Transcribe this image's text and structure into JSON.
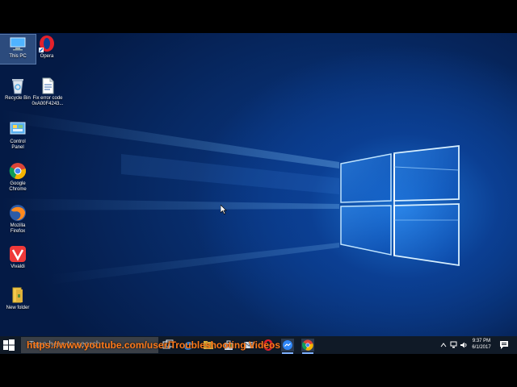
{
  "desktop": {
    "icons": [
      {
        "label_line1": "This PC",
        "label_line2": "",
        "icon": "this-pc-icon"
      },
      {
        "label_line1": "Opera",
        "label_line2": "",
        "icon": "opera-icon"
      },
      {
        "label_line1": "Recycle Bin",
        "label_line2": "",
        "icon": "recycle-bin-icon"
      },
      {
        "label_line1": "Fix error code",
        "label_line2": "0xA00F4243...",
        "icon": "document-icon"
      },
      {
        "label_line1": "Control",
        "label_line2": "Panel",
        "icon": "control-panel-icon"
      },
      {
        "label_line1": "Google",
        "label_line2": "Chrome",
        "icon": "chrome-icon"
      },
      {
        "label_line1": "Mozilla",
        "label_line2": "Firefox",
        "icon": "firefox-icon"
      },
      {
        "label_line1": "Vivaldi",
        "label_line2": "",
        "icon": "vivaldi-icon"
      },
      {
        "label_line1": "New folder",
        "label_line2": "",
        "icon": "folder-icon"
      }
    ]
  },
  "taskbar": {
    "search_placeholder": "Type here to search",
    "watermark": "https://www.youtube.com/user/Troubleshooting Videos",
    "pinned": [
      "task-view-icon",
      "edge-icon",
      "file-explorer-icon",
      "store-icon",
      "mail-icon",
      "opera-icon",
      "messenger-icon",
      "chrome-icon"
    ],
    "time": "9:37 PM",
    "date": "6/1/2017"
  },
  "colors": {
    "taskbar": "#101a27",
    "watermark": "#ff7a1a",
    "accent": "#1b6fd0"
  }
}
